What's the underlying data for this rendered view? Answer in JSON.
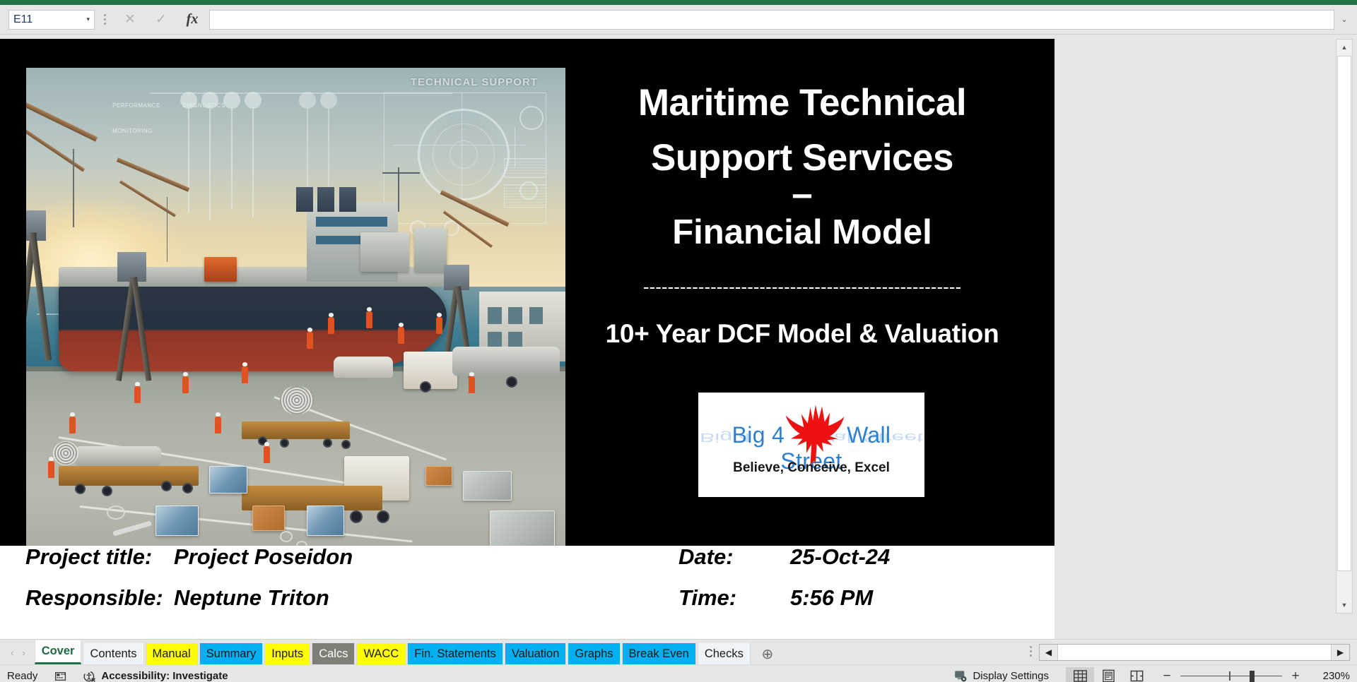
{
  "app": {
    "accent_green": "#217346",
    "tab_yellow": "#ffff00",
    "tab_cyan": "#00b0f0",
    "tab_grey": "#7c8077"
  },
  "formula_bar": {
    "name_box_value": "E11",
    "name_box_caret": "▾",
    "cancel_icon": "✕",
    "confirm_icon": "✓",
    "function_icon": "fx",
    "formula_value": "",
    "expand_caret": "⌄"
  },
  "cover": {
    "title_line1": "Maritime Technical",
    "title_line2": "Support Services",
    "title_dash": "–",
    "title_line3": "Financial Model",
    "divider": "----------------------------------------------------",
    "tagline": "10+ Year DCF Model & Valuation",
    "artwork": {
      "hud_label": "TECHNICAL SUPPORT",
      "alt": "Maritime port scene with cranes, cargo ship, trucks and dock workers"
    },
    "logo": {
      "brand_left": "Big 4",
      "brand_right": "Wall Street",
      "slogan": "Believe, Conceive, Excel",
      "brand_color": "#2f7fd1",
      "eagle_color": "#ee1111"
    },
    "info": {
      "project_title_label": "Project title:",
      "project_title_value": "Project Poseidon",
      "responsible_label": "Responsible:",
      "responsible_value": "Neptune Triton",
      "date_label": "Date:",
      "date_value": "25-Oct-24",
      "time_label": "Time:",
      "time_value": "5:56 PM"
    }
  },
  "sheet_tabs": {
    "prev_icon": "‹",
    "next_icon": "›",
    "add_icon": "⊕",
    "items": [
      {
        "label": "Cover",
        "style": "active"
      },
      {
        "label": "Contents",
        "style": "plain"
      },
      {
        "label": "Manual",
        "style": "yellow"
      },
      {
        "label": "Summary",
        "style": "cyan"
      },
      {
        "label": "Inputs",
        "style": "yellow"
      },
      {
        "label": "Calcs",
        "style": "grey"
      },
      {
        "label": "WACC",
        "style": "yellow"
      },
      {
        "label": "Fin. Statements",
        "style": "cyan"
      },
      {
        "label": "Valuation",
        "style": "cyan"
      },
      {
        "label": "Graphs",
        "style": "cyan"
      },
      {
        "label": "Break Even",
        "style": "cyan"
      },
      {
        "label": "Checks",
        "style": "plain"
      }
    ]
  },
  "scrollbars": {
    "v_up": "▲",
    "v_down": "▼",
    "h_left": "◀",
    "h_right": "▶"
  },
  "status_bar": {
    "mode": "Ready",
    "macro_icon": "record-macro-icon",
    "accessibility": "Accessibility: Investigate",
    "display_settings": "Display Settings",
    "view_normal": "normal-view-icon",
    "view_page_layout": "page-layout-view-icon",
    "view_page_break": "page-break-view-icon",
    "zoom_out": "−",
    "zoom_in": "+",
    "zoom_level": "230%"
  }
}
